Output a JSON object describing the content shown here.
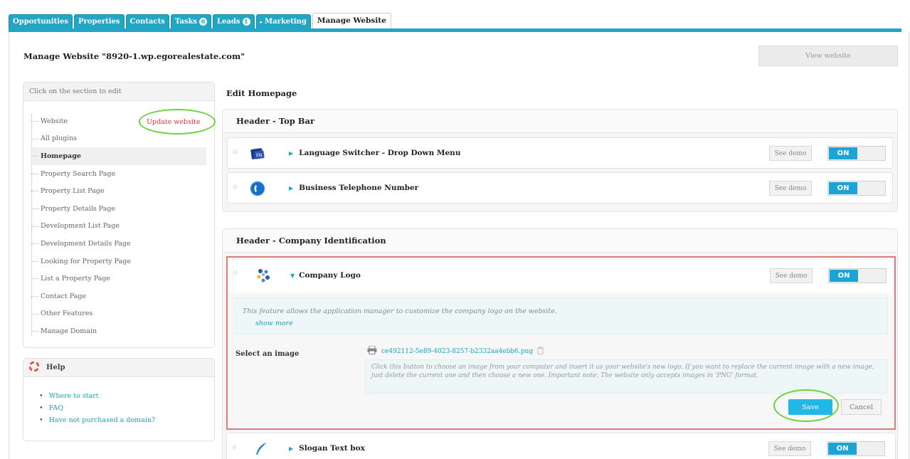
{
  "tabs": [
    {
      "label": "Opportunities"
    },
    {
      "label": "Properties"
    },
    {
      "label": "Contacts"
    },
    {
      "label": "Tasks",
      "badge": "0"
    },
    {
      "label": "Leads",
      "badge": "1"
    },
    {
      "label": "Marketing"
    },
    {
      "label": "Manage Website"
    }
  ],
  "page": {
    "title": "Manage Website \"8920-1.wp.egorealestate.com\"",
    "view_button": "View website"
  },
  "sidebar": {
    "header": "Click on the section to edit",
    "update_link": "Update website",
    "items": [
      {
        "label": "Website"
      },
      {
        "label": "All plugins"
      },
      {
        "label": "Homepage",
        "active": true
      },
      {
        "label": "Property Search Page"
      },
      {
        "label": "Property List Page"
      },
      {
        "label": "Property Details Page"
      },
      {
        "label": "Development List Page"
      },
      {
        "label": "Development Details Page"
      },
      {
        "label": "Looking for Property Page"
      },
      {
        "label": "List a Property Page"
      },
      {
        "label": "Contact Page"
      },
      {
        "label": "Other Features"
      },
      {
        "label": "Manage Domain"
      }
    ]
  },
  "help": {
    "title": "Help",
    "links": [
      {
        "label": "Where to start"
      },
      {
        "label": "FAQ"
      },
      {
        "label": "Have not purchased a domain?"
      }
    ]
  },
  "main": {
    "title": "Edit Homepage",
    "sections": [
      {
        "title": "Header - Top Bar",
        "features": [
          {
            "name": "Language Switcher - Drop Down Menu",
            "icon": "language-icon",
            "demo": "See demo",
            "toggle": "ON"
          },
          {
            "name": "Business Telephone Number",
            "icon": "phone-icon",
            "demo": "See demo",
            "toggle": "ON"
          }
        ]
      },
      {
        "title": "Header - Company Identification",
        "features": [
          {
            "name": "Company Logo",
            "icon": "logo-icon",
            "demo": "See demo",
            "toggle": "ON",
            "expanded": true
          },
          {
            "name": "Slogan Text box",
            "icon": "feather-icon",
            "demo": "See demo",
            "toggle": "ON"
          }
        ]
      }
    ],
    "logo_panel": {
      "description": "This feature allows the application manager to customize the company logo on the website.",
      "show_more": "show more",
      "select_label": "Select an image",
      "file_name": "ce492112-5e89-4023-8257-b2332aa4ebb6.png",
      "file_note": "Click this button to choose an image from your computer and insert it as your website's new logo. If you want to replace the current image with a new image, just delete the current one and then choose a new one. Important note: The website only accepts images in 'PNG' format.",
      "save": "Save",
      "cancel": "Cancel"
    }
  }
}
